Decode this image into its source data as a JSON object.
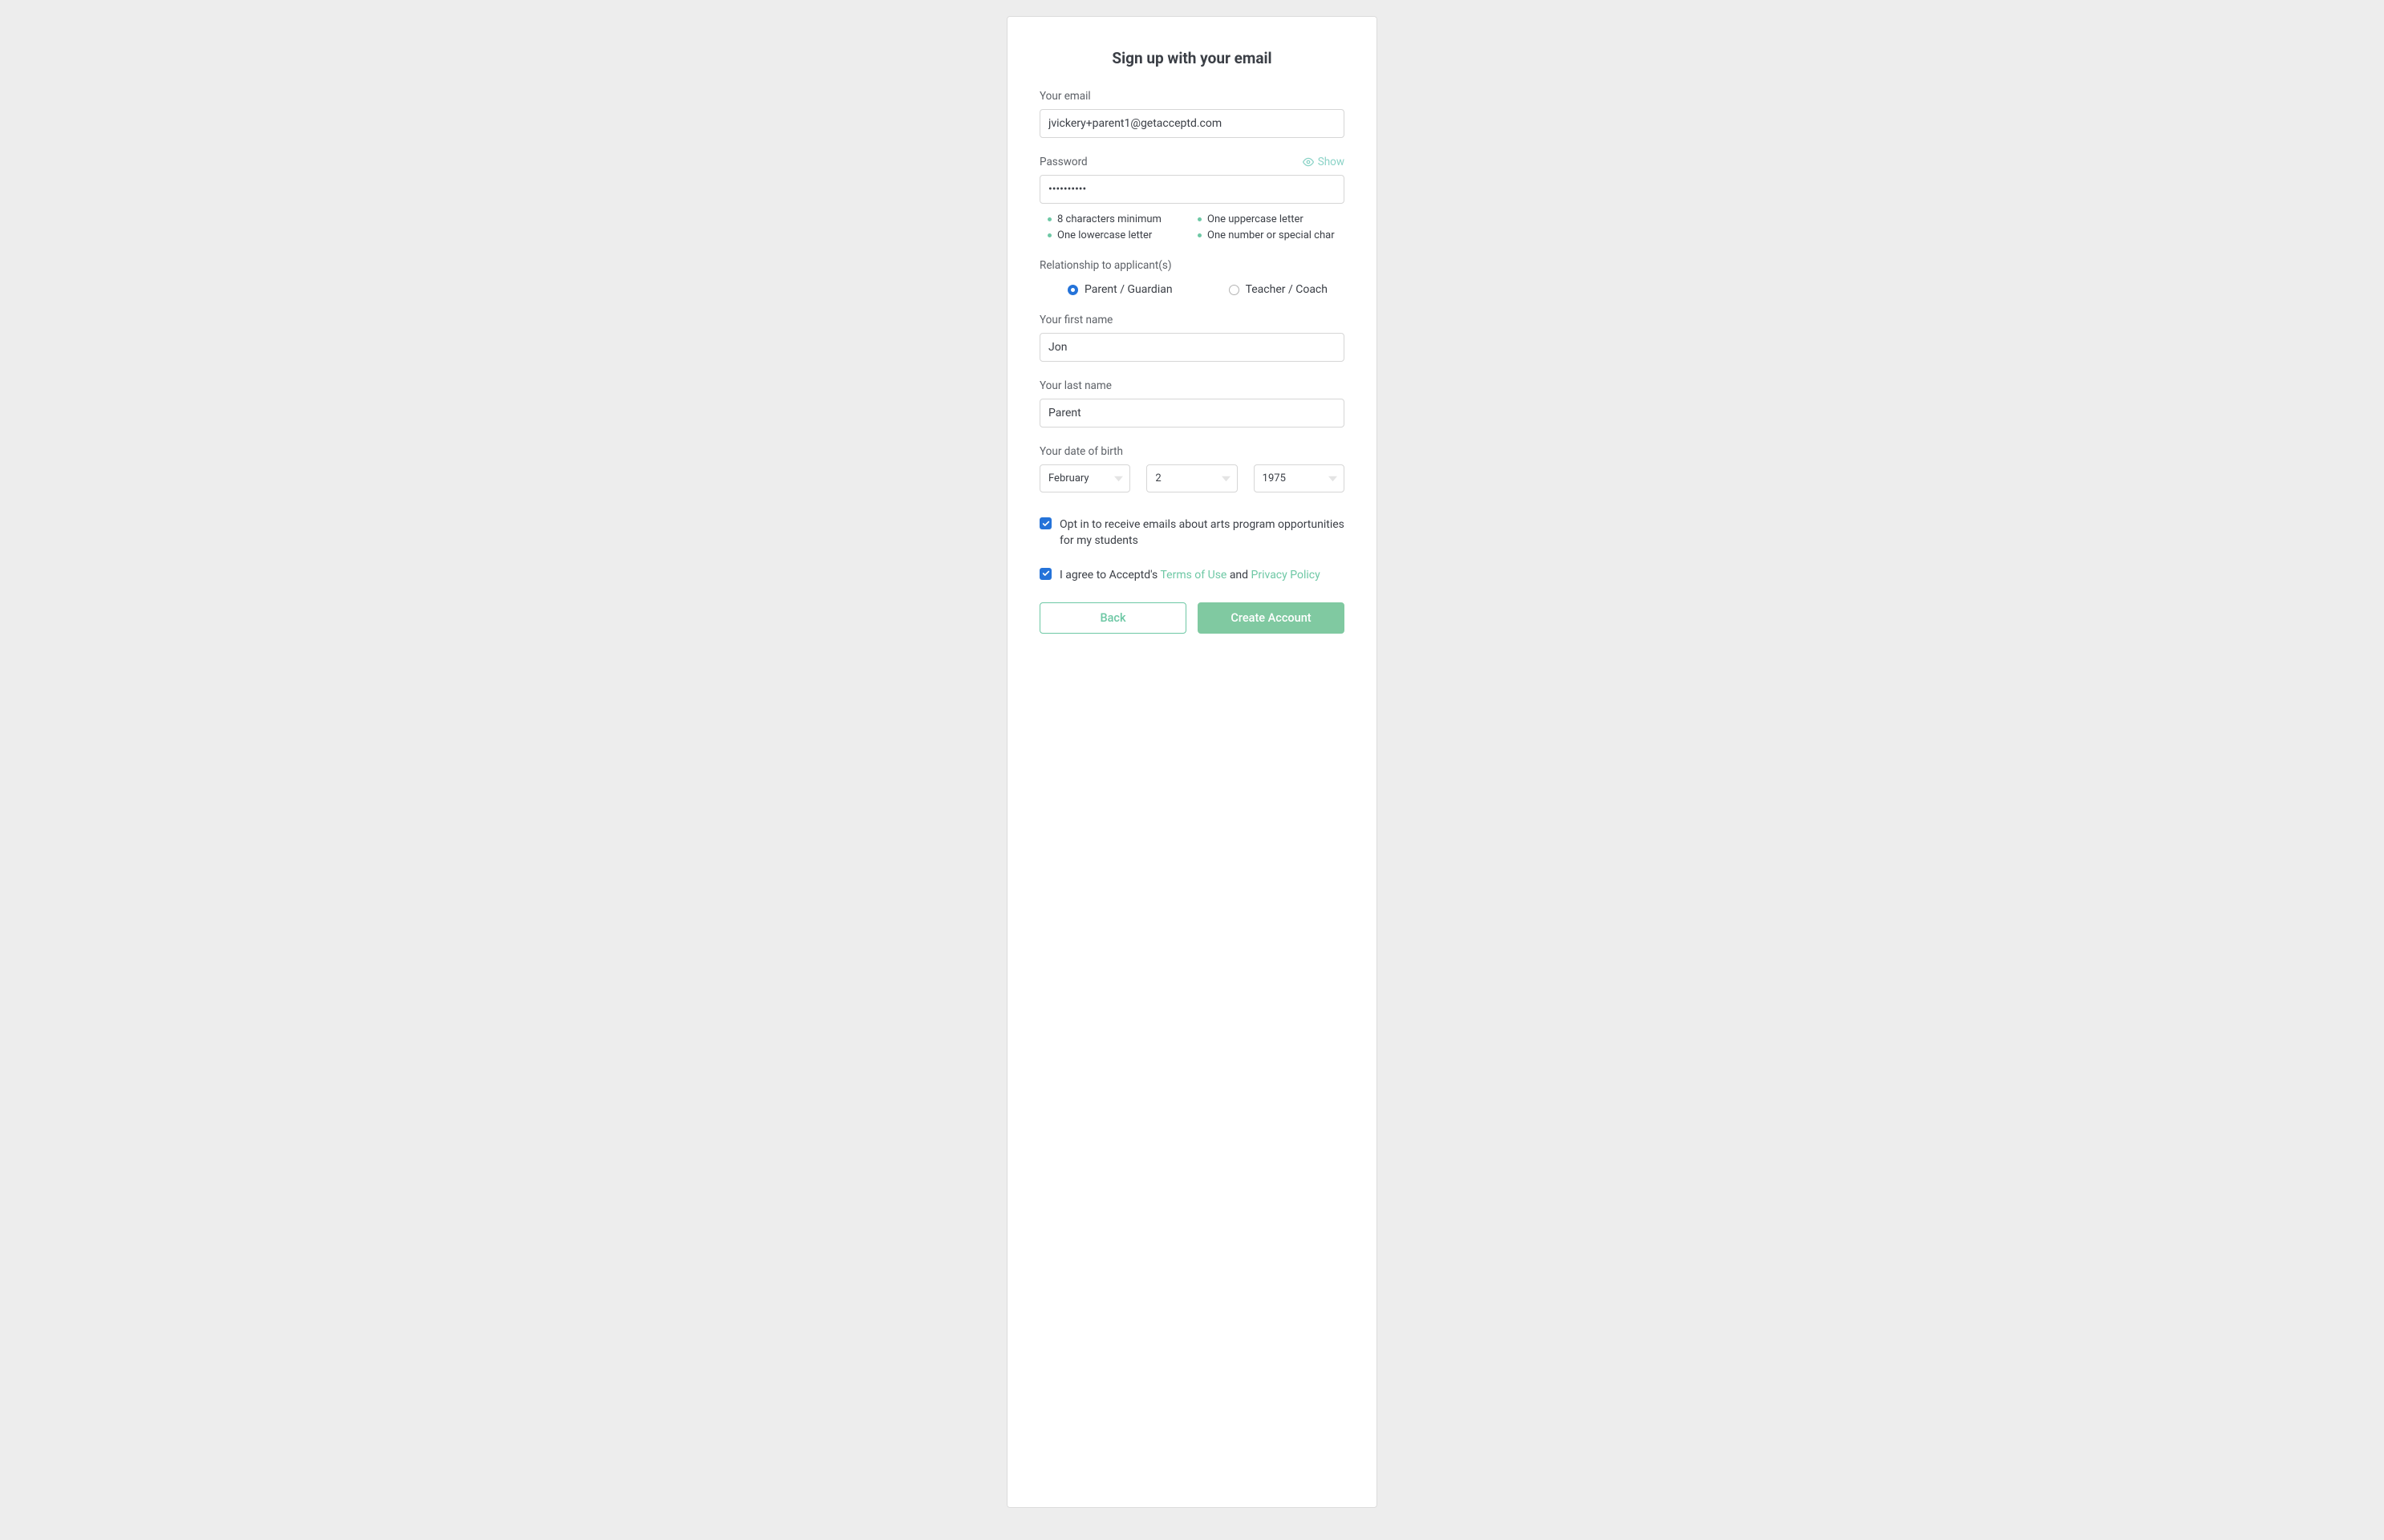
{
  "heading": "Sign up with your email",
  "email": {
    "label": "Your email",
    "value": "jvickery+parent1@getacceptd.com"
  },
  "password": {
    "label": "Password",
    "show_label": "Show",
    "value": "••••••••••",
    "rules": {
      "r1": "8 characters minimum",
      "r2": "One uppercase letter",
      "r3": "One lowercase letter",
      "r4": "One number or special char"
    }
  },
  "relationship": {
    "label": "Relationship to applicant(s)",
    "option1": "Parent / Guardian",
    "option2": "Teacher / Coach"
  },
  "first_name": {
    "label": "Your first name",
    "value": "Jon"
  },
  "last_name": {
    "label": "Your last name",
    "value": "Parent"
  },
  "dob": {
    "label": "Your date of birth",
    "month": "February",
    "day": "2",
    "year": "1975"
  },
  "optin_label": "Opt in to receive emails about arts program opportunities for my students",
  "agree": {
    "prefix": "I agree to Acceptd's ",
    "terms": "Terms of Use",
    "and": " and ",
    "privacy": "Privacy Policy"
  },
  "buttons": {
    "back": "Back",
    "create": "Create Account"
  }
}
